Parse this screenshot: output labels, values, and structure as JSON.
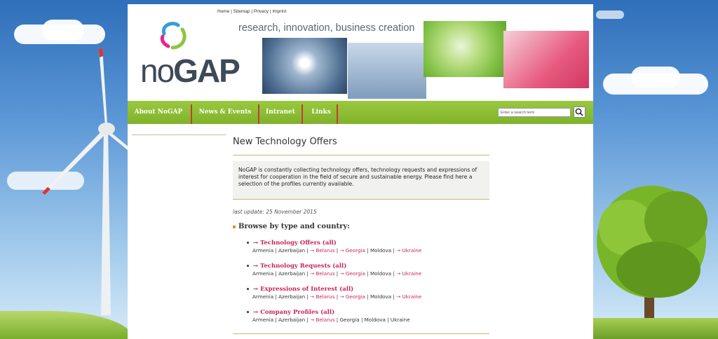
{
  "top_links": [
    "Home",
    "Sitemap",
    "Privacy",
    "Imprint"
  ],
  "logo": {
    "text_thin": "no",
    "text_bold": "GAP"
  },
  "tagline": "research, innovation, business creation",
  "nav": [
    "About NoGAP",
    "News & Events",
    "Intranet",
    "Links"
  ],
  "search": {
    "placeholder": "Enter a search term"
  },
  "main": {
    "title": "New Technology Offers",
    "intro": "NoGAP is constantly collecting technology offers, technology requests and expressions of interest for cooperation in the field of secure and sustainable energy. Please find here a selection of the profiles currently available.",
    "last_update": "last update: 25 November 2015",
    "browse_heading": "Browse by type and country:",
    "groups": [
      {
        "title": "→ Technology Offers (all)",
        "countries": [
          {
            "name": "Armenia",
            "link": false
          },
          {
            "name": "Azerbaijan",
            "link": false
          },
          {
            "name": "→ Belarus",
            "link": true
          },
          {
            "name": "→ Georgia",
            "link": true
          },
          {
            "name": "Moldova",
            "link": false
          },
          {
            "name": "→ Ukraine",
            "link": true
          }
        ]
      },
      {
        "title": "→ Technology Requests (all)",
        "countries": [
          {
            "name": "Armenia",
            "link": false
          },
          {
            "name": "Azerbaijan",
            "link": false
          },
          {
            "name": "→ Belarus",
            "link": true
          },
          {
            "name": "→ Georgia",
            "link": true
          },
          {
            "name": "Moldova",
            "link": false
          },
          {
            "name": "→ Ukraine",
            "link": true
          }
        ]
      },
      {
        "title": "→ Expressions of Interest (all)",
        "countries": [
          {
            "name": "Armenia",
            "link": false
          },
          {
            "name": "Azerbaijan",
            "link": false
          },
          {
            "name": "→ Belarus",
            "link": true
          },
          {
            "name": "→ Georgia",
            "link": true
          },
          {
            "name": "Moldova",
            "link": false
          },
          {
            "name": "→ Ukraine",
            "link": true
          }
        ]
      },
      {
        "title": "→ Company Profiles (all)",
        "countries": [
          {
            "name": "Armenia",
            "link": false
          },
          {
            "name": "Azerbaijan",
            "link": false
          },
          {
            "name": "→ Belarus",
            "link": true
          },
          {
            "name": "Georgia",
            "link": false
          },
          {
            "name": "Moldova",
            "link": false
          },
          {
            "name": "Ukraine",
            "link": false
          }
        ]
      }
    ]
  },
  "colors": {
    "nav_green": "#8dbf33",
    "link_red": "#c8245a",
    "rule_gold": "#c4b777"
  }
}
